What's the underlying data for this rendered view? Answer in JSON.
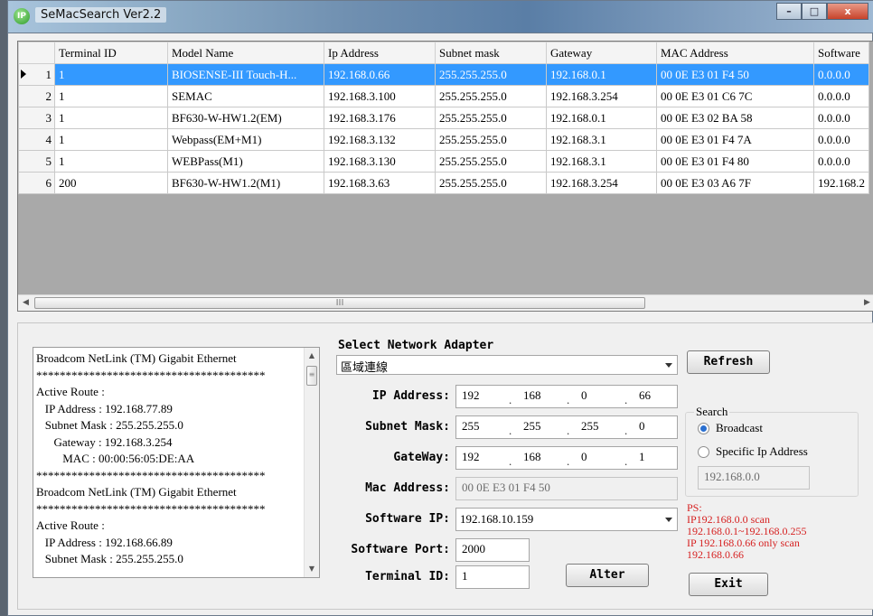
{
  "window": {
    "title": "SeMacSearch Ver2.2",
    "icon_label": "IP",
    "controls": {
      "minimize": "–",
      "maximize": "□",
      "close": "x"
    }
  },
  "grid": {
    "columns": [
      "Terminal ID",
      "Model Name",
      "Ip Address",
      "Subnet mask",
      "Gateway",
      "MAC Address",
      "Software"
    ],
    "rows": [
      {
        "num": "1",
        "cells": [
          "1",
          "BIOSENSE-III Touch-H...",
          "192.168.0.66",
          "255.255.255.0",
          "192.168.0.1",
          "00 0E E3 01 F4 50",
          "0.0.0.0"
        ],
        "selected": true
      },
      {
        "num": "2",
        "cells": [
          "1",
          "SEMAC",
          "192.168.3.100",
          "255.255.255.0",
          "192.168.3.254",
          "00 0E E3 01 C6 7C",
          "0.0.0.0"
        ]
      },
      {
        "num": "3",
        "cells": [
          "1",
          "BF630-W-HW1.2(EM)",
          "192.168.3.176",
          "255.255.255.0",
          "192.168.0.1",
          "00 0E E3 02 BA 58",
          "0.0.0.0"
        ]
      },
      {
        "num": "4",
        "cells": [
          "1",
          "Webpass(EM+M1)",
          "192.168.3.132",
          "255.255.255.0",
          "192.168.3.1",
          "00 0E E3 01 F4 7A",
          "0.0.0.0"
        ]
      },
      {
        "num": "5",
        "cells": [
          "1",
          "WEBPass(M1)",
          "192.168.3.130",
          "255.255.255.0",
          "192.168.3.1",
          "00 0E E3 01 F4 80",
          "0.0.0.0"
        ]
      },
      {
        "num": "6",
        "cells": [
          "200",
          "BF630-W-HW1.2(M1)",
          "192.168.3.63",
          "255.255.255.0",
          "192.168.3.254",
          "00 0E E3 03 A6 7F",
          "192.168.2"
        ]
      }
    ],
    "hscroll": {
      "left": "◀",
      "right": "▶",
      "grip": "III"
    }
  },
  "log": {
    "lines": [
      "Broadcom NetLink (TM) Gigabit Ethernet",
      "***************************************",
      "Active Route :",
      "   IP Address : 192.168.77.89",
      "   Subnet Mask : 255.255.255.0",
      "      Gateway : 192.168.3.254",
      "         MAC : 00:00:56:05:DE:AA",
      "***************************************",
      "Broadcom NetLink (TM) Gigabit Ethernet",
      "***************************************",
      "Active Route :",
      "   IP Address : 192.168.66.89",
      "   Subnet Mask : 255.255.255.0"
    ],
    "vscroll": {
      "up": "▲",
      "down": "▼",
      "grip": "≡"
    }
  },
  "adapter": {
    "title": "Select Network Adapter",
    "selected": "區域連線",
    "ip_label": "IP Address:",
    "ip": [
      "192",
      "168",
      "0",
      "66"
    ],
    "subnet_label": "Subnet Mask:",
    "subnet": [
      "255",
      "255",
      "255",
      "0"
    ],
    "gateway_label": "GateWay:",
    "gateway": [
      "192",
      "168",
      "0",
      "1"
    ],
    "mac_label": "Mac Address:",
    "mac": "00 0E E3 01 F4 50",
    "software_ip_label": "Software IP:",
    "software_ip": "192.168.10.159",
    "software_port_label": "Software Port:",
    "software_port": "2000",
    "terminal_id_label": "Terminal ID:",
    "terminal_id": "1",
    "alter_label": "Alter"
  },
  "right": {
    "refresh_label": "Refresh",
    "search_legend": "Search",
    "broadcast_label": "Broadcast",
    "specific_label": "Specific Ip Address",
    "specific_ip": "192.168.0.0",
    "search_mode": "Broadcast",
    "ps_text": "PS:\nIP192.168.0.0 scan\n192.168.0.1~192.168.0.255\nIP 192.168.0.66 only scan\n192.168.0.66",
    "exit_label": "Exit"
  },
  "colors": {
    "selection": "#3399ff",
    "ps_text": "#d62121"
  }
}
